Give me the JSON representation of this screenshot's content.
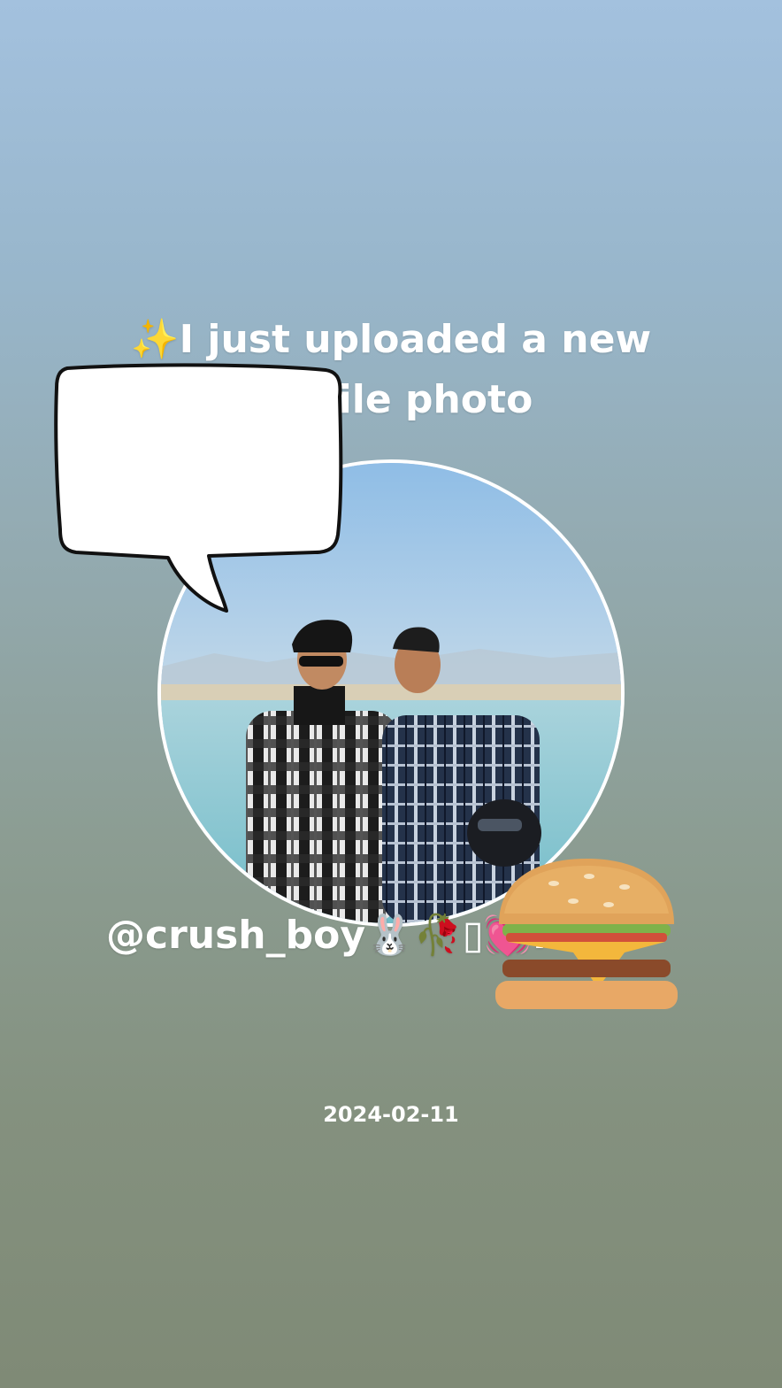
{
  "story": {
    "headline_icon": "sparkles-icon",
    "headline_prefix": "✨",
    "headline_text": "I just uploaded a new profile photo",
    "username": "@crush_boy🐰🥀▯💓.<3",
    "date": "2024-02-11",
    "stickers": [
      "speech-bubble-icon",
      "burger-icon"
    ]
  },
  "colors": {
    "bg_top": "#a3c1de",
    "bg_bottom": "#7f8a76",
    "text": "#ffffff",
    "ring": "#ffffff"
  }
}
